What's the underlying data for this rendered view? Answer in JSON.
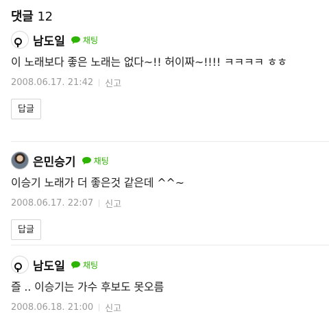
{
  "header": {
    "title": "댓글",
    "count": "12"
  },
  "comments": [
    {
      "author": "남도일",
      "chat_label": "채팅",
      "text": "이 노래보다 좋은 노래는 없다~!! 허이짜~!!!! ㅋㅋㅋㅋ ㅎㅎ",
      "date": "2008.06.17. 21:42",
      "report": "신고",
      "reply": "답글"
    },
    {
      "author": "은민승기",
      "chat_label": "채팅",
      "text": "이승기 노래가 더 좋은것 같은데 ^^~",
      "date": "2008.06.17. 22:07",
      "report": "신고",
      "reply": "답글"
    },
    {
      "author": "남도일",
      "chat_label": "채팅",
      "text": "즐 .. 이승기는 가수 후보도 못오름",
      "date": "2008.06.18. 21:00",
      "report": "신고"
    }
  ],
  "colors": {
    "chat_green": "#2db400",
    "meta_gray": "#9a9a9a"
  }
}
